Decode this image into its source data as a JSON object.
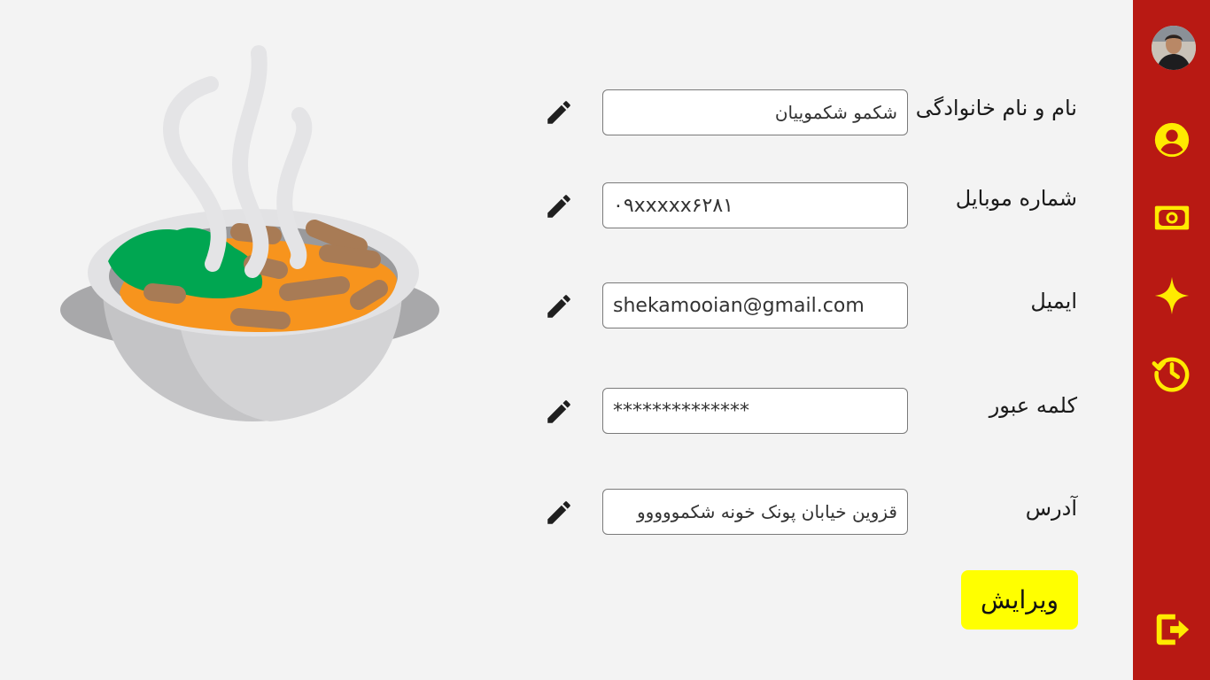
{
  "profile": {
    "fields": [
      {
        "label": "نام و نام خانوادگی",
        "value": "شکمو شکموییان"
      },
      {
        "label": "شماره موبایل",
        "value": "۰۹xxxxx۶۲۸۱"
      },
      {
        "label": "ایمیل",
        "value": "shekamooian@gmail.com"
      },
      {
        "label": "کلمه عبور",
        "value": "**************"
      },
      {
        "label": "آدرس",
        "value": "قزوین خیابان پونک خونه شکمووووو"
      }
    ],
    "edit_button_label": "ویرایش"
  },
  "sidebar": {
    "icons": [
      "avatar",
      "account-icon",
      "money-icon",
      "sparkle-icon",
      "history-icon",
      "logout-icon"
    ]
  },
  "colors": {
    "sidebar_bg": "#b81913",
    "icon_yellow": "#ffea00",
    "button_yellow": "#ffff00",
    "page_bg": "#f3f3f3"
  }
}
